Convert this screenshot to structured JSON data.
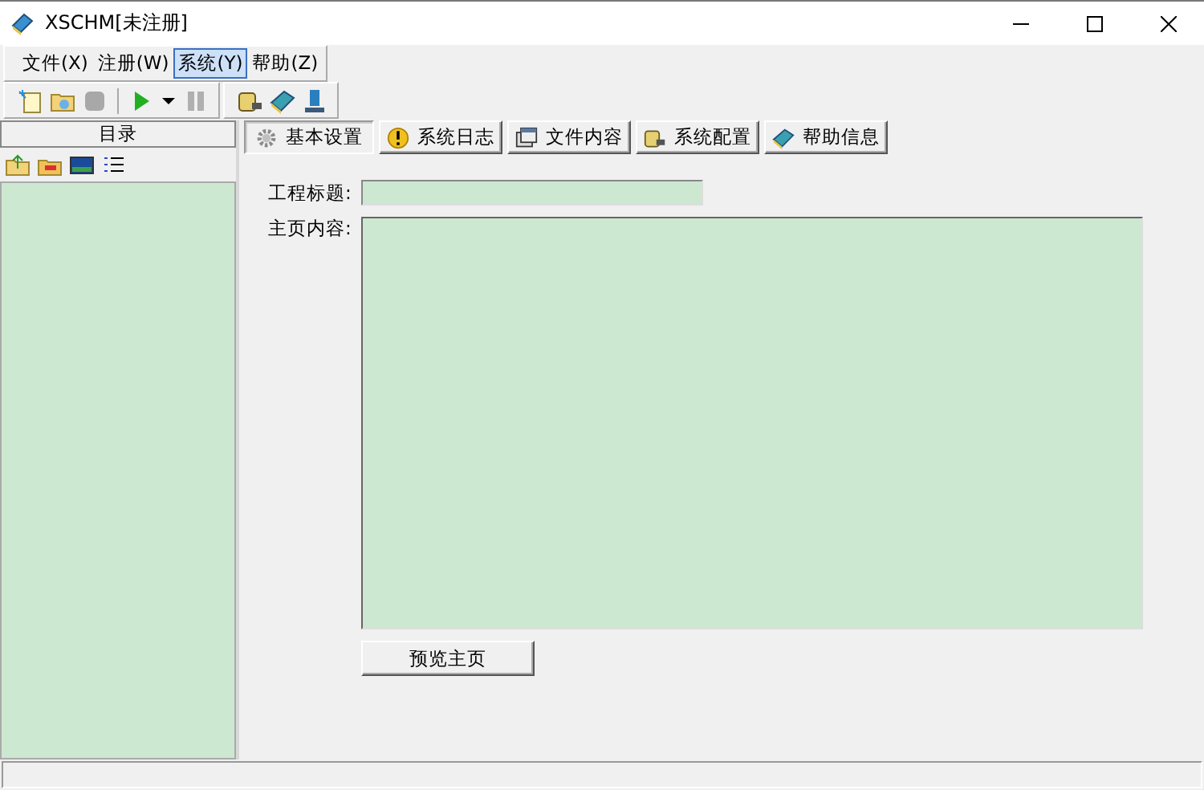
{
  "window": {
    "title": "XSCHM[未注册]"
  },
  "menu": [
    {
      "label": "文件(X)",
      "selected": false
    },
    {
      "label": "注册(W)",
      "selected": false
    },
    {
      "label": "系统(Y)",
      "selected": true
    },
    {
      "label": "帮助(Z)",
      "selected": false
    }
  ],
  "sidebar": {
    "title": "目录"
  },
  "tabs": [
    {
      "label": "基本设置",
      "selected": true
    },
    {
      "label": "系统日志",
      "selected": false
    },
    {
      "label": "文件内容",
      "selected": false
    },
    {
      "label": "系统配置",
      "selected": false
    },
    {
      "label": "帮助信息",
      "selected": false
    }
  ],
  "form": {
    "title_label": "工程标题:",
    "content_label": "主页内容:",
    "preview_button": "预览主页"
  }
}
